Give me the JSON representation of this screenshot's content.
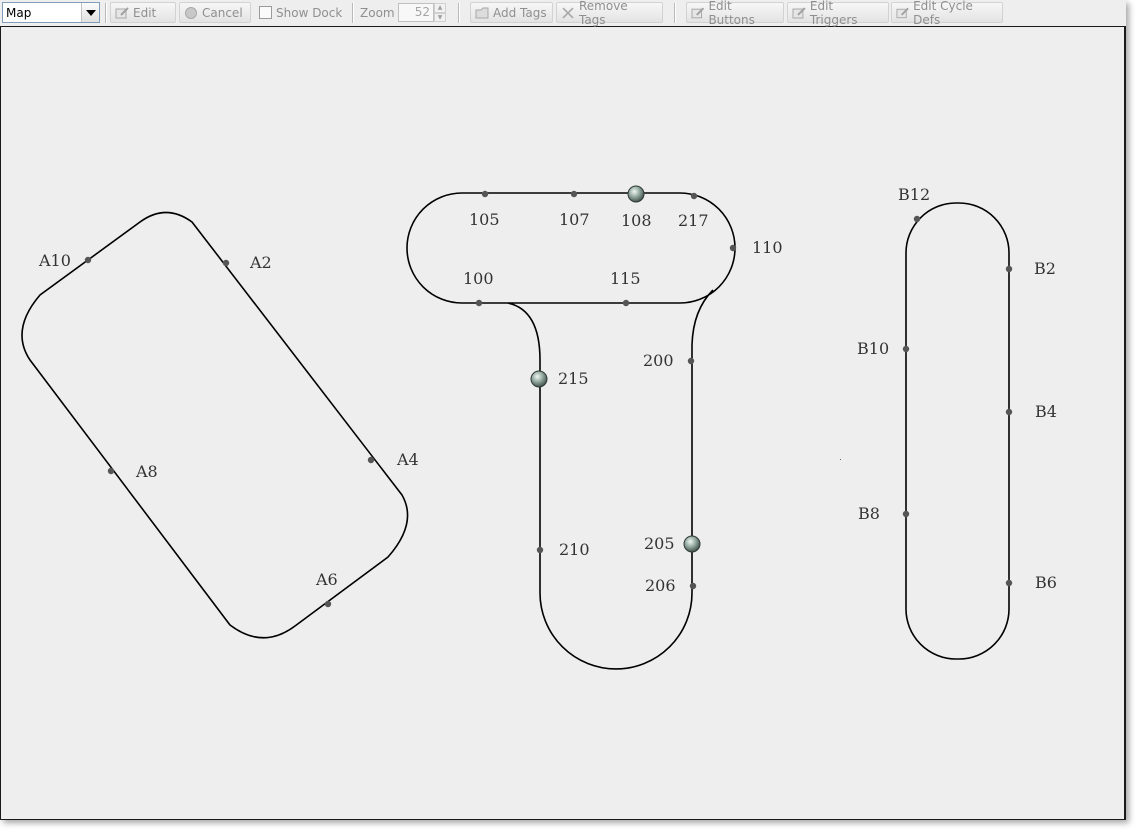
{
  "toolbar": {
    "view_select": "Map",
    "edit_label": "Edit",
    "cancel_label": "Cancel",
    "show_dock_label": "Show Dock",
    "zoom_label": "Zoom",
    "zoom_value": "52",
    "add_tags_label": "Add Tags",
    "remove_tags_label": "Remove Tags",
    "edit_buttons_label": "Edit Buttons",
    "edit_triggers_label": "Edit Triggers",
    "edit_cycle_defs_label": "Edit Cycle Defs"
  },
  "map": {
    "track_a_labels": [
      "A10",
      "A2",
      "A4",
      "A8",
      "A6"
    ],
    "track_center_labels": [
      "105",
      "107",
      "108",
      "217",
      "110",
      "100",
      "115",
      "215",
      "200",
      "210",
      "205",
      "206"
    ],
    "track_b_labels": [
      "B12",
      "B2",
      "B10",
      "B4",
      "B8",
      "B6"
    ]
  }
}
